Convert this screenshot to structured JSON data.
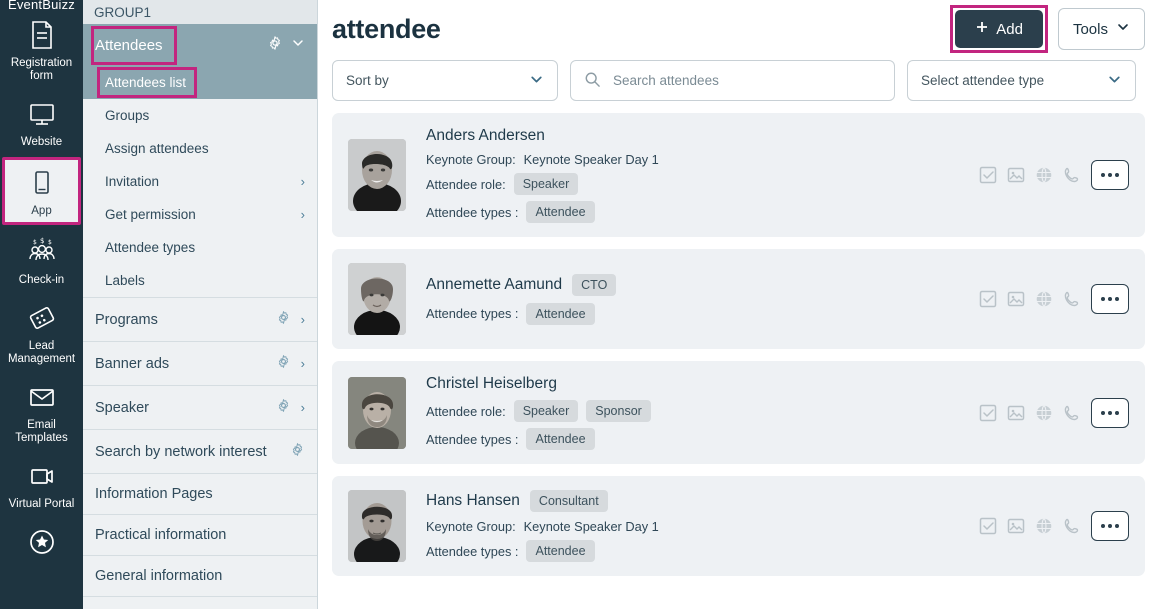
{
  "brand": "EventBuizz",
  "rail": {
    "items": [
      {
        "label": "Registration form",
        "icon": "document-icon",
        "active": false
      },
      {
        "label": "Website",
        "icon": "monitor-icon",
        "active": false
      },
      {
        "label": "App",
        "icon": "mobile-icon",
        "active": true
      },
      {
        "label": "Check-in",
        "icon": "people-money-icon",
        "active": false
      },
      {
        "label": "Lead Management",
        "icon": "badge-icon",
        "active": false
      },
      {
        "label": "Email Templates",
        "icon": "envelope-icon",
        "active": false
      },
      {
        "label": "Virtual Portal",
        "icon": "video-camera-icon",
        "active": false
      },
      {
        "label": "",
        "icon": "star-circle-icon",
        "active": false
      }
    ]
  },
  "subnav": {
    "group_title": "GROUP1",
    "section": {
      "label": "Attendees",
      "gear_icon": "gear-icon",
      "chevron_icon": "chevron-down-icon",
      "highlighted": true
    },
    "sub_items": [
      {
        "label": "Attendees list",
        "selected": true,
        "highlighted": true,
        "chevron": false
      },
      {
        "label": "Groups",
        "selected": false,
        "highlighted": false,
        "chevron": false
      },
      {
        "label": "Assign attendees",
        "selected": false,
        "highlighted": false,
        "chevron": false
      },
      {
        "label": "Invitation",
        "selected": false,
        "highlighted": false,
        "chevron": true
      },
      {
        "label": "Get permission",
        "selected": false,
        "highlighted": false,
        "chevron": true
      },
      {
        "label": "Attendee types",
        "selected": false,
        "highlighted": false,
        "chevron": false
      },
      {
        "label": "Labels",
        "selected": false,
        "highlighted": false,
        "chevron": false
      }
    ],
    "nav_rows": [
      {
        "label": "Programs",
        "gear": true,
        "chevron": true
      },
      {
        "label": "Banner ads",
        "gear": true,
        "chevron": true
      },
      {
        "label": "Speaker",
        "gear": true,
        "chevron": true
      },
      {
        "label": "Search by network interest",
        "gear": true,
        "chevron": false
      },
      {
        "label": "Information Pages",
        "gear": false,
        "chevron": false
      },
      {
        "label": "Practical information",
        "gear": false,
        "chevron": false
      },
      {
        "label": "General information",
        "gear": false,
        "chevron": false
      }
    ]
  },
  "header": {
    "title": "attendee",
    "add_label": "Add",
    "add_icon": "plus-icon",
    "tools_label": "Tools",
    "tools_icon": "chevron-down-icon"
  },
  "filters": {
    "sort_by_label": "Sort by",
    "search_placeholder": "Search attendees",
    "search_value": "",
    "search_icon": "search-icon",
    "attendee_type_label": "Select attendee type"
  },
  "labels": {
    "keynote_group": "Keynote Group:",
    "attendee_role": "Attendee role:",
    "attendee_types": "Attendee types :"
  },
  "attendees": [
    {
      "name": "Anders Andersen",
      "title_badge": "",
      "keynote_group": "Keynote Speaker Day 1",
      "roles": [
        "Speaker"
      ],
      "types": [
        "Attendee"
      ],
      "avatar": "male-smiling-photo"
    },
    {
      "name": "Annemette Aamund",
      "title_badge": "CTO",
      "keynote_group": "",
      "roles": [],
      "types": [
        "Attendee"
      ],
      "avatar": "female-photo"
    },
    {
      "name": "Christel Heiselberg",
      "title_badge": "",
      "keynote_group": "",
      "roles": [
        "Speaker",
        "Sponsor"
      ],
      "types": [
        "Attendee"
      ],
      "avatar": "male-beard-photo"
    },
    {
      "name": "Hans Hansen",
      "title_badge": "Consultant",
      "keynote_group": "Keynote Speaker Day 1",
      "roles": [],
      "types": [
        "Attendee"
      ],
      "avatar": "male-short-hair-photo"
    }
  ],
  "row_actions": [
    {
      "icon": "check-square-icon"
    },
    {
      "icon": "image-icon"
    },
    {
      "icon": "globe-icon"
    },
    {
      "icon": "phone-icon"
    }
  ],
  "more_button_icon": "more-dots-icon",
  "colors": {
    "rail_bg": "#1e3440",
    "highlight": "#c2257f",
    "section_bg": "#8ba6b0",
    "subnav_bg": "#eef1f3",
    "card_bg": "#eef1f4",
    "accent_dark": "#2b3f4c"
  }
}
